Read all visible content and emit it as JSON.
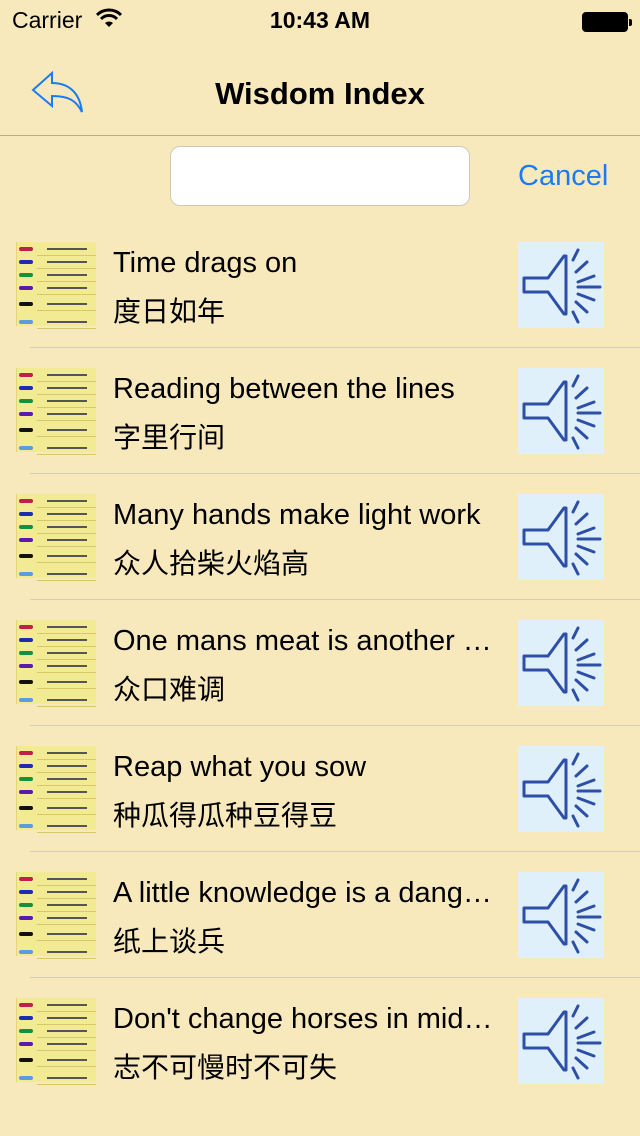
{
  "status_bar": {
    "carrier": "Carrier",
    "time": "10:43 AM"
  },
  "nav": {
    "title": "Wisdom Index",
    "back_icon": "reply-arrow-icon"
  },
  "search": {
    "value": "",
    "placeholder": "",
    "cancel_label": "Cancel"
  },
  "colors": {
    "background": "#f8e9bd",
    "accent": "#1a7cf5",
    "speaker": "#2d4fa8"
  },
  "items": [
    {
      "english": "Time drags on",
      "chinese": "度日如年"
    },
    {
      "english": "Reading between the lines",
      "chinese": "字里行间"
    },
    {
      "english": "Many hands make light work",
      "chinese": "众人拾柴火焰高"
    },
    {
      "english": "One mans meat is another mans poison",
      "chinese": "众口难调"
    },
    {
      "english": "Reap what you sow",
      "chinese": "种瓜得瓜种豆得豆"
    },
    {
      "english": "A little knowledge is a dangerous thing",
      "chinese": "纸上谈兵"
    },
    {
      "english": "Don't change horses in midstream",
      "chinese": "志不可慢时不可失"
    }
  ]
}
